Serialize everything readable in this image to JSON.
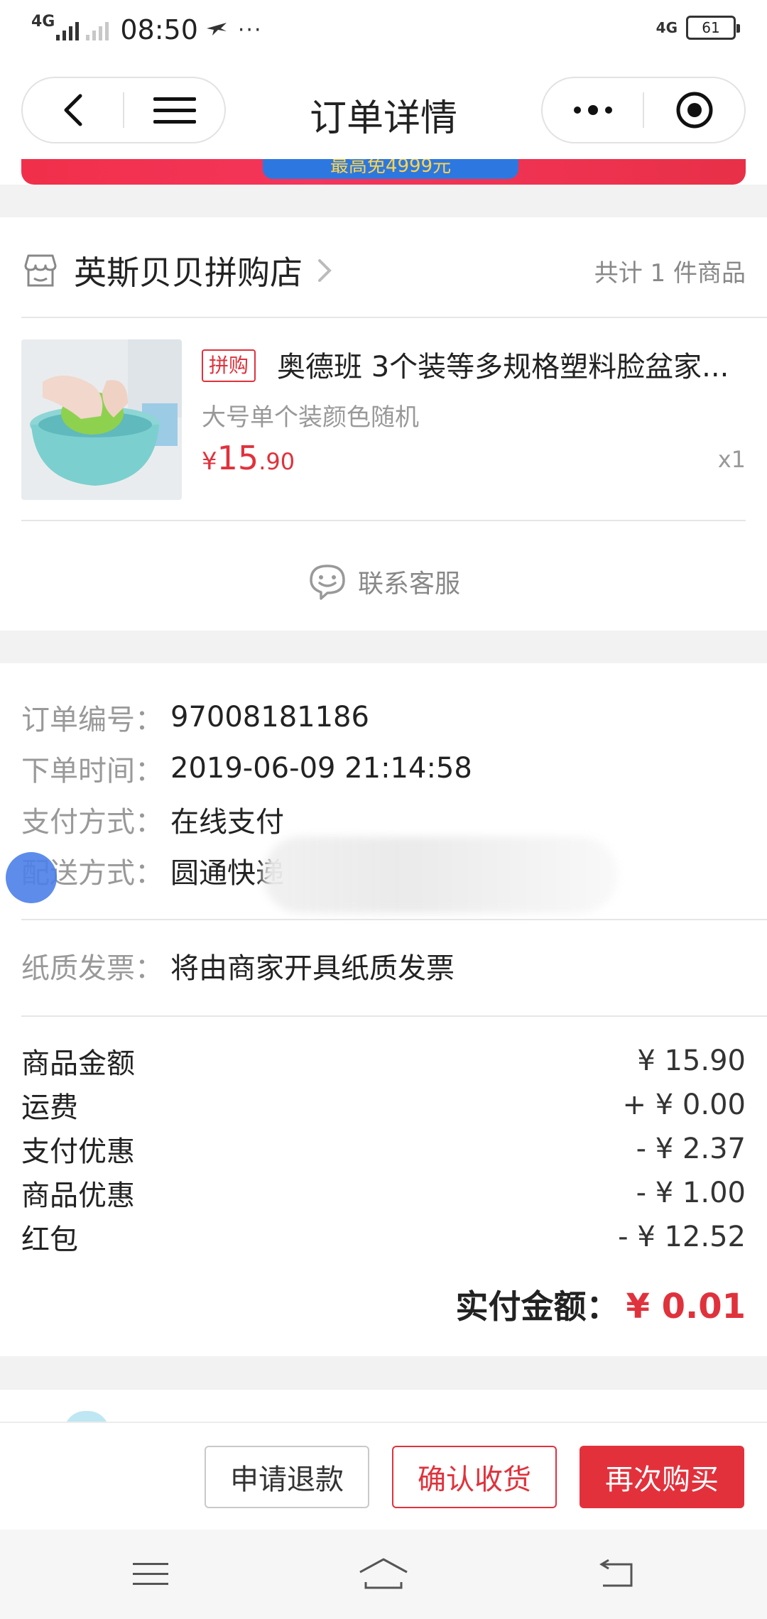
{
  "status_bar": {
    "network": "4G",
    "time": "08:50",
    "extra": "···",
    "network_right": "4G",
    "battery": "61"
  },
  "navbar": {
    "title": "订单详情"
  },
  "banner": {
    "text": "最高免4999元"
  },
  "shop": {
    "name": "英斯贝贝拼购店",
    "count_text": "共计 1 件商品"
  },
  "product": {
    "tag": "拼购",
    "title": "奥德班 3个装等多规格塑料脸盆家...",
    "spec": "大号单个装颜色随机",
    "price_currency": "¥",
    "price_int": "15",
    "price_dec": ".90",
    "quantity": "x1"
  },
  "contact_service": {
    "label": "联系客服"
  },
  "order_info": {
    "rows": [
      {
        "key": "订单编号：",
        "value": "97008181186"
      },
      {
        "key": "下单时间：",
        "value": "2019-06-09 21:14:58"
      },
      {
        "key": "支付方式：",
        "value": "在线支付"
      },
      {
        "key": "配送方式：",
        "value": "圆通快递"
      }
    ],
    "invoice": {
      "key": "纸质发票：",
      "value": "将由商家开具纸质发票"
    }
  },
  "amounts": [
    {
      "label": "商品金额",
      "value": "¥ 15.90"
    },
    {
      "label": "运费",
      "value": "+ ¥ 0.00"
    },
    {
      "label": "支付优惠",
      "value": "- ¥ 2.37"
    },
    {
      "label": "商品优惠",
      "value": "- ¥ 1.00"
    },
    {
      "label": "红包",
      "value": "- ¥ 12.52"
    }
  ],
  "total": {
    "label": "实付金额：",
    "value": "¥ 0.01"
  },
  "actions": {
    "refund": "申请退款",
    "confirm": "确认收货",
    "rebuy": "再次购买"
  },
  "colors": {
    "accent": "#e0323c",
    "muted": "#999999",
    "divider": "#f2f2f2"
  }
}
